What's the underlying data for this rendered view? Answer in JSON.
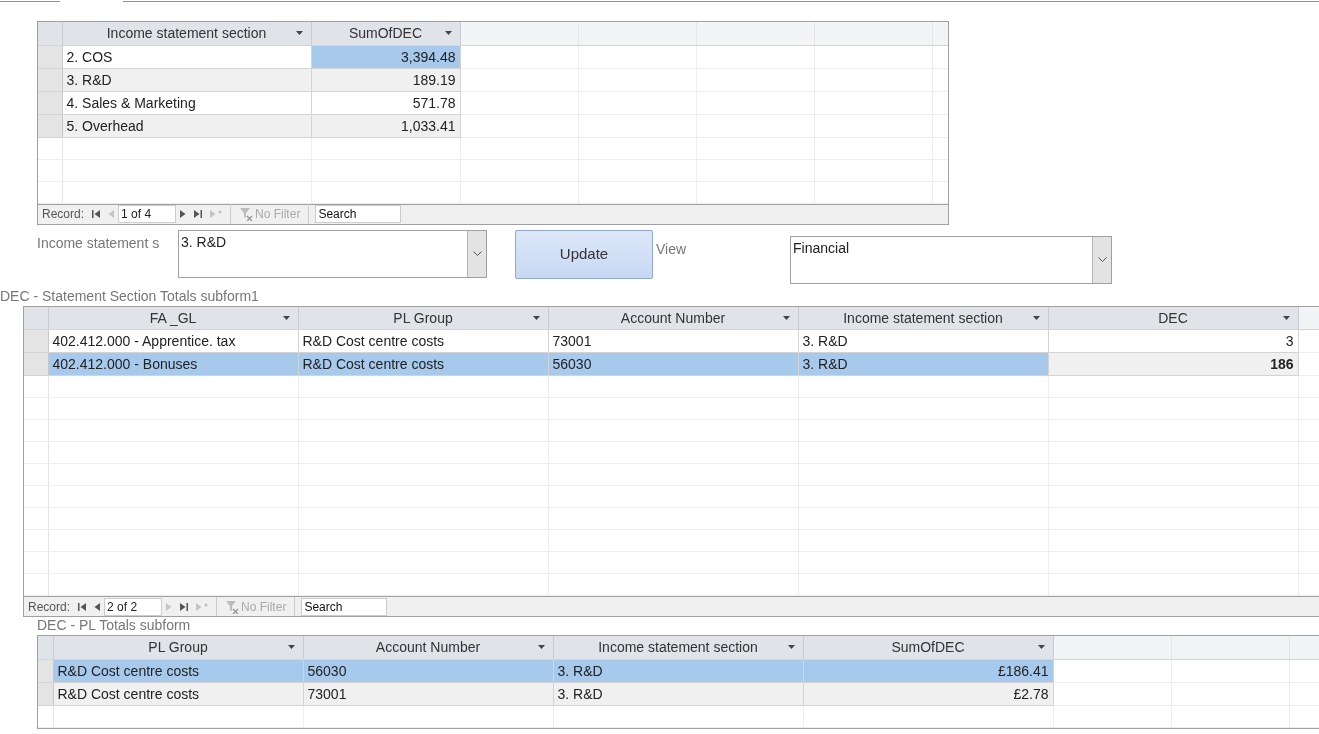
{
  "datasheets": [
    {
      "columns": [
        "Income statement section",
        "SumOfDEC"
      ],
      "rows": [
        {
          "cells": [
            {
              "text": "2. COS",
              "selected": false
            },
            {
              "text": "3,394.48",
              "selected": true
            }
          ]
        },
        {
          "cells": [
            {
              "text": "3. R&D",
              "selected": false
            },
            {
              "text": "189.19",
              "selected": false
            }
          ]
        },
        {
          "cells": [
            {
              "text": "4. Sales & Marketing",
              "selected": false
            },
            {
              "text": "571.78",
              "selected": false
            }
          ]
        },
        {
          "cells": [
            {
              "text": "5. Overhead",
              "selected": false
            },
            {
              "text": "1,033.41",
              "selected": false
            }
          ]
        }
      ],
      "navigation": {
        "label": "Record:",
        "position": "1 of 4",
        "buttons": [
          {
            "kind": "first",
            "disabled": false
          },
          {
            "kind": "previous",
            "disabled": true
          },
          {
            "kind": "next",
            "disabled": false
          },
          {
            "kind": "last",
            "disabled": false
          },
          {
            "kind": "new",
            "disabled": true
          }
        ],
        "filter": "No Filter",
        "search": {
          "placeholder": "Search"
        }
      }
    },
    {
      "caption": "DEC - Statement Section Totals subform1",
      "columns": [
        "FA _GL",
        "PL Group",
        "Account Number",
        "Income statement section",
        "DEC"
      ],
      "rows": [
        {
          "cells": [
            {
              "text": "402.412.000 - Apprentice. tax",
              "selected": false
            },
            {
              "text": "R&D Cost centre costs",
              "selected": false
            },
            {
              "text": "73001",
              "selected": false
            },
            {
              "text": "3. R&D",
              "selected": false
            },
            {
              "text": "3",
              "selected": false
            }
          ]
        },
        {
          "cells": [
            {
              "text": "402.412.000 - Bonuses",
              "selected": true
            },
            {
              "text": "R&D Cost centre costs",
              "selected": true
            },
            {
              "text": "56030",
              "selected": true
            },
            {
              "text": "3. R&D",
              "selected": true
            },
            {
              "text": "186",
              "selected": false
            }
          ]
        }
      ],
      "navigation": {
        "label": "Record:",
        "position": "2 of 2",
        "buttons": [
          {
            "kind": "first",
            "disabled": false
          },
          {
            "kind": "previous",
            "disabled": false
          },
          {
            "kind": "next",
            "disabled": true
          },
          {
            "kind": "last",
            "disabled": false
          },
          {
            "kind": "new",
            "disabled": true
          }
        ],
        "filter": "No Filter",
        "search": {
          "placeholder": "Search"
        }
      }
    },
    {
      "caption": "DEC - PL Totals subform",
      "columns": [
        "PL Group",
        "Account Number",
        "Income statement section",
        "SumOfDEC"
      ],
      "rows": [
        {
          "cells": [
            {
              "text": "R&D Cost centre costs",
              "selected": true
            },
            {
              "text": "56030",
              "selected": true
            },
            {
              "text": "3. R&D",
              "selected": true
            },
            {
              "text": "£186.41",
              "selected": true
            }
          ]
        },
        {
          "cells": [
            {
              "text": "R&D Cost centre costs",
              "selected": false
            },
            {
              "text": "73001",
              "selected": false
            },
            {
              "text": "3. R&D",
              "selected": false
            },
            {
              "text": "£2.78",
              "selected": false
            }
          ]
        }
      ]
    }
  ],
  "form": {
    "section_label": "Income statement s",
    "section_combo": "3. R&D",
    "update_button": "Update",
    "view_label": "View",
    "view_combo": "Financial"
  }
}
